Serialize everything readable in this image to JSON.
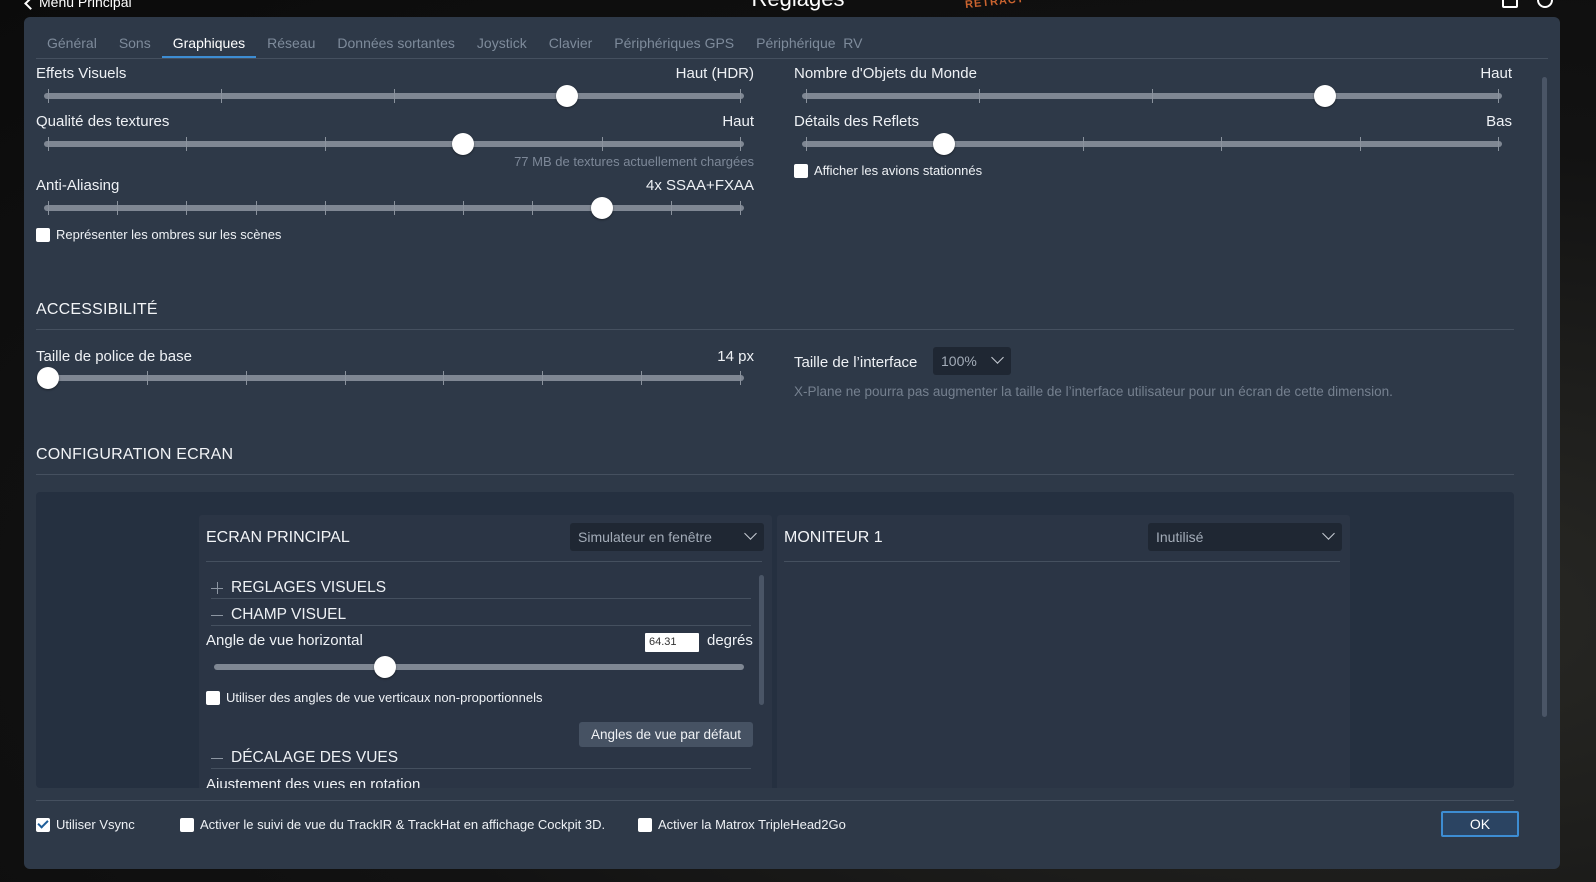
{
  "topbar": {
    "back_label": "Menu Principal",
    "title": "Réglages",
    "background_text": "RETRACT"
  },
  "tabs": [
    {
      "label": "Général",
      "active": false
    },
    {
      "label": "Sons",
      "active": false
    },
    {
      "label": "Graphiques",
      "active": true
    },
    {
      "label": "Réseau",
      "active": false
    },
    {
      "label": "Données sortantes",
      "active": false
    },
    {
      "label": "Joystick",
      "active": false
    },
    {
      "label": "Clavier",
      "active": false
    },
    {
      "label": "Périphériques GPS",
      "active": false
    },
    {
      "label": "Périphérique  RV",
      "active": false
    }
  ],
  "graphics": {
    "visual_effects": {
      "label": "Effets Visuels",
      "value": "Haut (HDR)",
      "level": 0.75
    },
    "texture_quality": {
      "label": "Qualité des textures",
      "value": "Haut",
      "level": 0.6,
      "note": "77 MB de textures actuellement chargées"
    },
    "anti_aliasing": {
      "label": "Anti-Aliasing",
      "value": "4x SSAA+FXAA",
      "level": 0.8
    },
    "shadows_checkbox": {
      "label": "Représenter les ombres sur les scènes",
      "checked": false
    },
    "world_objects": {
      "label": "Nombre d'Objets du Monde",
      "value": "Haut",
      "level": 0.75
    },
    "reflection_detail": {
      "label": "Détails des Reflets",
      "value": "Bas",
      "level": 0.2
    },
    "parked_planes_checkbox": {
      "label": "Afficher les avions stationnés",
      "checked": false
    }
  },
  "accessibility": {
    "title": "ACCESSIBILITÉ",
    "font_size": {
      "label": "Taille de police de base",
      "value": "14 px",
      "level": 0.0
    },
    "ui_size": {
      "label": "Taille de l’interface",
      "selected": "100%"
    },
    "ui_size_hint": "X-Plane ne pourra pas augmenter la taille de l’interface utilisateur pour un écran de cette dimension."
  },
  "screen_config": {
    "title": "CONFIGURATION ECRAN",
    "main": {
      "title": "ECRAN PRINCIPAL",
      "mode_selected": "Simulateur en fenêtre",
      "visual_settings": "REGLAGES VISUELS",
      "field_of_view": "CHAMP VISUEL",
      "h_angle_label": "Angle de vue horizontal",
      "h_angle_value": "64.31",
      "h_angle_unit": "degrés",
      "h_angle_level": 0.32,
      "nonprop_checkbox": {
        "label": "Utiliser des angles de vue verticaux non-proportionnels",
        "checked": false
      },
      "default_angles_button": "Angles de vue par défaut",
      "view_offset": "DÉCALAGE DES VUES",
      "rotation_label": "Ajustement des vues en rotation"
    },
    "monitor1": {
      "title": "MONITEUR 1",
      "mode_selected": "Inutilisé"
    }
  },
  "footer": {
    "vsync": {
      "label": "Utiliser Vsync",
      "checked": true
    },
    "trackir": {
      "label": "Activer le suivi de vue du TrackIR & TrackHat en affichage Cockpit 3D.",
      "checked": false
    },
    "matrox": {
      "label": "Activer la Matrox TripleHead2Go",
      "checked": false
    },
    "ok_label": "OK"
  },
  "colors": {
    "panel": "#2e3948",
    "accent": "#3d8dd3",
    "track": "#7f8793"
  },
  "icons": {
    "back": "chevron-left-icon",
    "dropdown": "chevron-down-icon",
    "expand": "plus-icon",
    "collapse": "minus-icon"
  }
}
